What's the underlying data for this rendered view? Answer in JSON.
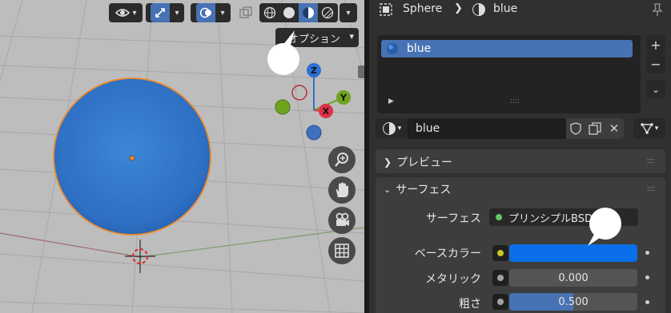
{
  "viewport": {
    "options_label": "オプション",
    "gizmo": {
      "z": "Z",
      "y": "Y",
      "x": "X"
    },
    "object": {
      "color": "#2f72c8"
    },
    "nav_icons": [
      "zoom-icon",
      "hand-pan-icon",
      "camera-icon",
      "grid-view-icon"
    ],
    "header_icons": [
      "select-visibility-icon",
      "gizmo-icon",
      "overlay-icon",
      "xray-icon",
      "shading-wireframe-icon",
      "shading-solid-icon",
      "shading-material-icon",
      "shading-rendered-icon"
    ]
  },
  "properties": {
    "breadcrumb": {
      "object": "Sphere",
      "material": "blue"
    },
    "slot_list": {
      "items": [
        "blue"
      ]
    },
    "material_field": {
      "name": "blue"
    },
    "panels": {
      "preview": "プレビュー",
      "surface": "サーフェス"
    },
    "surface": {
      "shader_label": "サーフェス",
      "shader_value": "プリンシプルBSDF",
      "base_color_label": "ベースカラー",
      "base_color": "#0a6fe8",
      "metallic_label": "メタリック",
      "metallic_value": "0.000",
      "metallic_fraction": 0.0,
      "roughness_label": "粗さ",
      "roughness_value": "0.500",
      "roughness_fraction": 0.5
    },
    "colors": {
      "accent": "#4772b3",
      "socket_yellow": "#c7c729",
      "socket_green": "#63c763",
      "socket_gray": "#a1a1a1"
    }
  }
}
